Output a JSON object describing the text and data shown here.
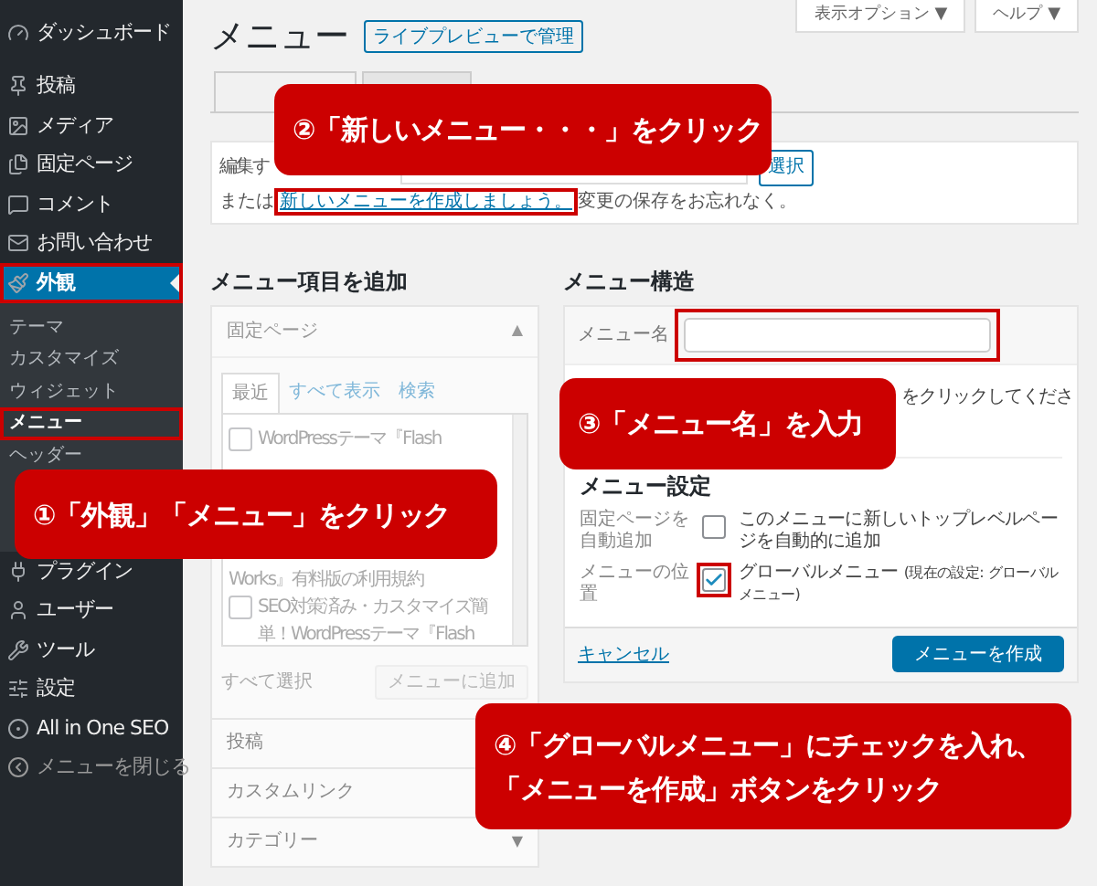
{
  "sidebar": {
    "items": [
      {
        "label": "ダッシュボード",
        "kind": "link",
        "selected": false,
        "annotated": false
      },
      {
        "label": "投稿",
        "kind": "link",
        "selected": false,
        "annotated": false
      },
      {
        "label": "メディア",
        "kind": "link",
        "selected": false,
        "annotated": false
      },
      {
        "label": "固定ページ",
        "kind": "link",
        "selected": false,
        "annotated": false
      },
      {
        "label": "コメント",
        "kind": "link",
        "selected": false,
        "annotated": false
      },
      {
        "label": "お問い合わせ",
        "kind": "link",
        "selected": false,
        "annotated": false
      },
      {
        "label": "外観",
        "kind": "link",
        "selected": true,
        "annotated": true,
        "children": [
          {
            "label": "テーマ",
            "selected": false,
            "annotated": false
          },
          {
            "label": "カスタマイズ",
            "selected": false,
            "annotated": false
          },
          {
            "label": "ウィジェット",
            "selected": false,
            "annotated": false
          },
          {
            "label": "メニュー",
            "selected": true,
            "annotated": true
          },
          {
            "label": "ヘッダー",
            "selected": false,
            "annotated": false
          }
        ]
      },
      {
        "label": "プラグイン",
        "kind": "link",
        "selected": false,
        "annotated": false
      },
      {
        "label": "ユーザー",
        "kind": "link",
        "selected": false,
        "annotated": false
      },
      {
        "label": "ツール",
        "kind": "link",
        "selected": false,
        "annotated": false
      },
      {
        "label": "設定",
        "kind": "link",
        "selected": false,
        "annotated": false
      },
      {
        "label": "All in One SEO",
        "kind": "link",
        "selected": false,
        "annotated": false
      },
      {
        "label": "メニューを閉じる",
        "kind": "collapse",
        "selected": false,
        "annotated": false
      }
    ]
  },
  "header": {
    "title": "メニュー",
    "preview_button": "ライブプレビューで管理",
    "screen_buttons": [
      "表示オプション ▼",
      "ヘルプ ▼"
    ]
  },
  "tabs": [
    {
      "selected": true
    },
    {
      "selected": false
    }
  ],
  "edit_box": {
    "label": "編集す",
    "select_button": "選択",
    "prefix": "または",
    "link": "新しいメニューを作成しましょう。",
    "link_annotated": true,
    "suffix": "変更の保存をお忘れなく。"
  },
  "add_items": {
    "heading": "メニュー項目を追加",
    "pages_panel": {
      "title": "固定ページ",
      "toggle": "▲",
      "tabs": [
        {
          "label": "最近",
          "selected": true
        },
        {
          "label": "すべて表示",
          "selected": false
        },
        {
          "label": "検索",
          "selected": false
        }
      ],
      "items": [
        {
          "kind": "option",
          "checked": false,
          "lines": [
            "WordPressテーマ『Flash"
          ]
        },
        {
          "kind": "continuation",
          "lines": [
            "Works』有料版の利用規約"
          ]
        },
        {
          "kind": "option",
          "checked": false,
          "lines": [
            "SEO対策済み・カスタマイズ簡",
            "単！WordPressテーマ『Flash"
          ]
        }
      ],
      "select_all": "すべて選択",
      "add_button": {
        "label": "メニューに追加",
        "disabled": true
      }
    },
    "sections": [
      {
        "label": "投稿"
      },
      {
        "label": "カスタムリンク"
      },
      {
        "label": "カテゴリー",
        "toggle": "▼"
      }
    ]
  },
  "structure": {
    "heading": "メニュー構造",
    "name_label": "メニュー名",
    "name_annotated": true,
    "hint": "をクリックしてくださ",
    "settings_heading": "メニュー設定",
    "settings": [
      {
        "label": "固定ページを自動追加",
        "checked": false,
        "annotated": false,
        "text": "このメニューに新しいトップレベルページを自動的に追加"
      },
      {
        "label": "メニューの位置",
        "checked": true,
        "annotated": true,
        "text": "グローバルメニュー",
        "note": "(現在の設定: グローバルメニュー)"
      }
    ],
    "cancel": "キャンセル",
    "create_button": "メニューを作成"
  },
  "callouts": [
    {
      "lines": [
        "①「外観」「メニュー」をクリック"
      ]
    },
    {
      "lines": [
        "②「新しいメニュー・・・」をクリック"
      ]
    },
    {
      "lines": [
        "③「メニュー名」を入力"
      ]
    },
    {
      "lines": [
        "④「グローバルメニュー」にチェックを入れ、",
        "「メニューを作成」ボタンをクリック"
      ]
    }
  ]
}
